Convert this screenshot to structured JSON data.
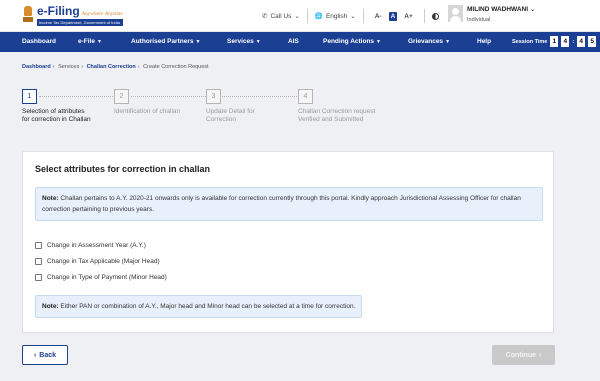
{
  "header": {
    "brand_name": "e-Filing",
    "brand_tagline": "Anywhere Anytime",
    "brand_subtitle": "Income Tax Department, Government of India",
    "call_us": "Call Us",
    "language": "English",
    "font_decrease": "A-",
    "font_default": "A",
    "font_increase": "A+",
    "user_name": "MILIND WADHWANI",
    "user_role": "Individual"
  },
  "nav": {
    "items": [
      {
        "label": "Dashboard",
        "dropdown": false
      },
      {
        "label": "e-File",
        "dropdown": true
      },
      {
        "label": "Authorised Partners",
        "dropdown": true
      },
      {
        "label": "Services",
        "dropdown": true
      },
      {
        "label": "AIS",
        "dropdown": false
      },
      {
        "label": "Pending Actions",
        "dropdown": true
      },
      {
        "label": "Grievances",
        "dropdown": true
      },
      {
        "label": "Help",
        "dropdown": false
      }
    ],
    "session_label": "Session Time",
    "session_digits": [
      "1",
      "4",
      "4",
      "5"
    ]
  },
  "breadcrumb": {
    "items": [
      "Dashboard",
      "Services",
      "Challan Correction",
      "Create Correction Request"
    ]
  },
  "steps": [
    {
      "number": "1",
      "label": "Selection of attributes for correction in Challan"
    },
    {
      "number": "2",
      "label": "Identification of challan"
    },
    {
      "number": "3",
      "label": "Update Detail for Correction"
    },
    {
      "number": "4",
      "label": "Challan Correction request Verified and Submitted"
    }
  ],
  "card": {
    "title": "Select attributes for correction in challan",
    "note1_prefix": "Note:",
    "note1_text": "Challan pertains to A.Y. 2020-21 onwards only is available for correction currently through this portal. Kindly approach Jurisdictional Assessing Officer for challan correction pertaining to previous years.",
    "options": [
      "Change in Assessment Year (A.Y.)",
      "Change in Tax Applicable (Major Head)",
      "Change in Type of Payment (Minor Head)"
    ],
    "note2_prefix": "Note:",
    "note2_text": "Either PAN or combination of A.Y., Major head and Minor head can be selected at a time for correction."
  },
  "buttons": {
    "back": "Back",
    "continue": "Continue"
  },
  "colors": {
    "primary": "#1b3f93",
    "note_bg": "#e8f1fb",
    "disabled": "#c9c9c9"
  }
}
